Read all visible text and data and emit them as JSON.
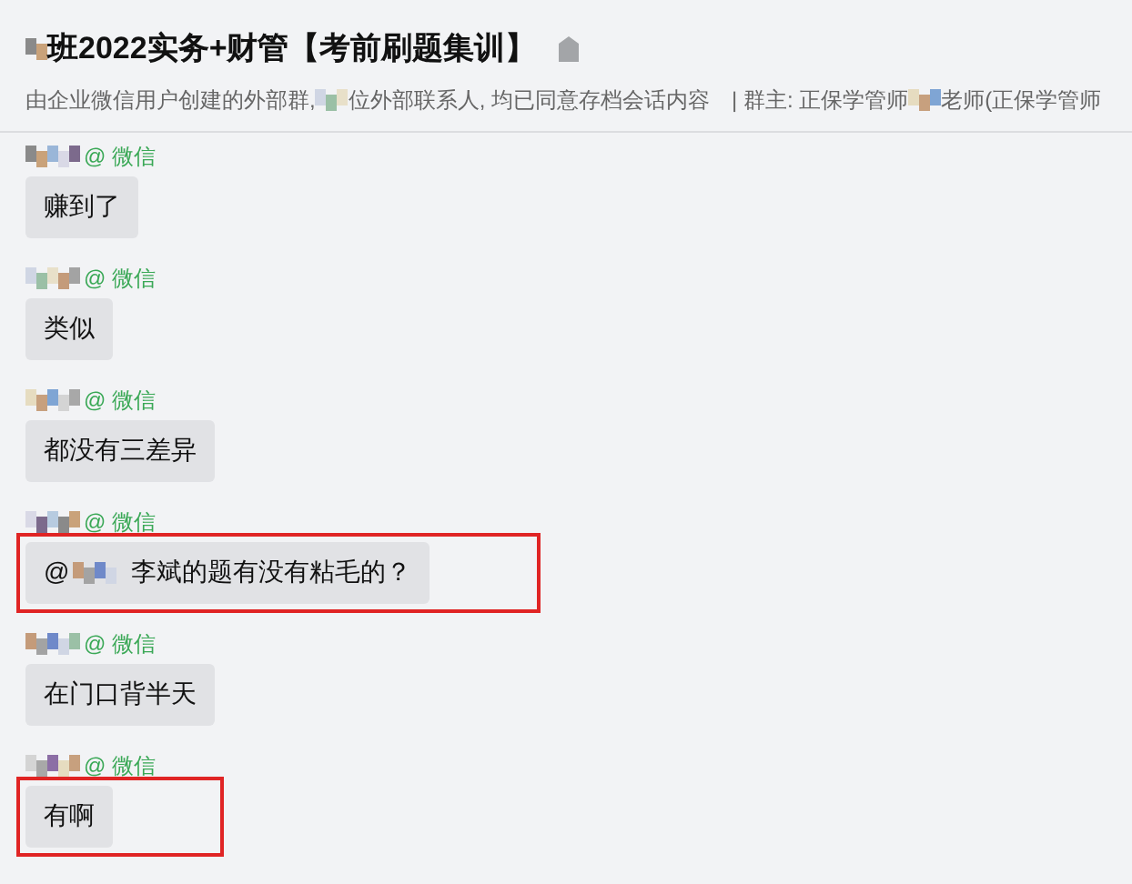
{
  "header": {
    "title": "班2022实务+财管【考前刷题集训】",
    "subtitle_before": "由企业微信用户创建的外部群, ",
    "subtitle_after": "位外部联系人, 均已同意存档会话内容",
    "owner_label": "| 群主: 正保学管师",
    "owner_after": "老师(正保学管师"
  },
  "messages": [
    {
      "sender": "@ 微信",
      "text": "赚到了",
      "highlighted": false
    },
    {
      "sender": "@ 微信",
      "text": "类似",
      "highlighted": false
    },
    {
      "sender": "@ 微信",
      "text": "都没有三差异",
      "highlighted": false
    },
    {
      "sender": "@ 微信",
      "mention": "@",
      "text": "李斌的题有没有粘毛的？",
      "highlighted": true
    },
    {
      "sender": "@ 微信",
      "text": "在门口背半天",
      "highlighted": false
    },
    {
      "sender": "@ 微信",
      "text": "有啊",
      "highlighted": true
    }
  ]
}
